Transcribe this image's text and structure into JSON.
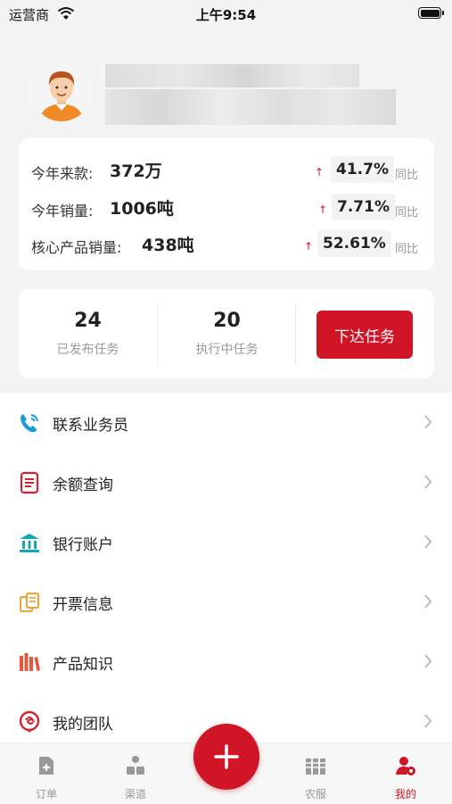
{
  "status_bar": {
    "carrier": "运营商",
    "time": "上午9:54"
  },
  "stats": [
    {
      "label": "今年来款:",
      "value": "372万",
      "pct": "41.7%",
      "compare": "同比",
      "trend": "up"
    },
    {
      "label": "今年销量:",
      "value": "1006吨",
      "pct": "7.71%",
      "compare": "同比",
      "trend": "up"
    },
    {
      "label": "核心产品销量:",
      "value": "438吨",
      "pct": "52.61%",
      "compare": "同比",
      "trend": "up"
    }
  ],
  "tasks": {
    "published": {
      "count": "24",
      "label": "已发布任务"
    },
    "in_progress": {
      "count": "20",
      "label": "执行中任务"
    },
    "issue_button": "下达任务"
  },
  "menu": [
    {
      "label": "联系业务员",
      "icon": "phone-icon",
      "color": "#1a9bd7"
    },
    {
      "label": "余额查询",
      "icon": "document-icon",
      "color": "#d0242f"
    },
    {
      "label": "银行账户",
      "icon": "bank-icon",
      "color": "#14a7b5"
    },
    {
      "label": "开票信息",
      "icon": "invoice-icon",
      "color": "#f0a23a"
    },
    {
      "label": "产品知识",
      "icon": "books-icon",
      "color": "#e8573b"
    },
    {
      "label": "我的团队",
      "icon": "team-icon",
      "color": "#d0242f"
    }
  ],
  "tabbar": [
    {
      "label": "订单",
      "icon": "order-icon"
    },
    {
      "label": "渠道",
      "icon": "channel-icon"
    },
    {
      "label": "农服",
      "icon": "agri-service-icon"
    },
    {
      "label": "我的",
      "icon": "profile-icon",
      "active": true
    }
  ],
  "colors": {
    "accent": "#cf1526",
    "background": "#f4f4f4",
    "card": "#ffffff"
  }
}
